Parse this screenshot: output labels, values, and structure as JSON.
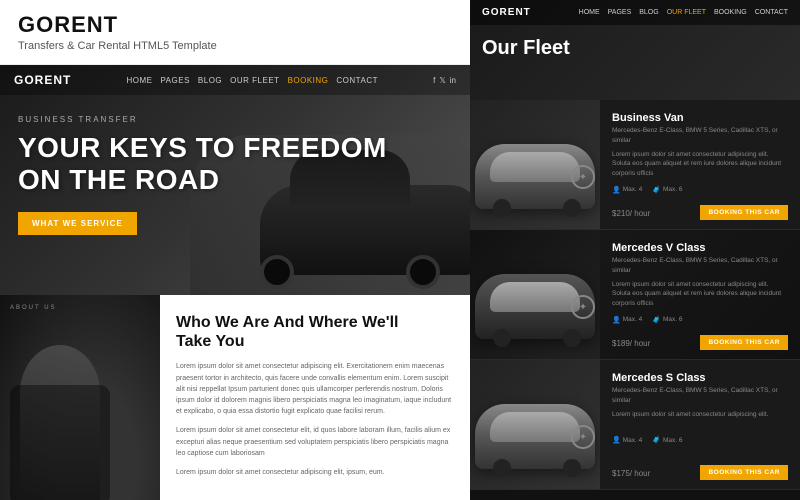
{
  "brand": {
    "name": "GORENT",
    "subtitle": "Transfers & Car Rental HTML5 Template"
  },
  "hero": {
    "nav_logo": "GORENT",
    "nav_links": [
      "HOME",
      "PAGES",
      "BLOG",
      "OUR FLEET",
      "BOOKING",
      "CONTACT"
    ],
    "subtitle": "BUSINESS TRANSFER",
    "title_line1": "Your Keys To Freedom",
    "title_line2": "On The Road",
    "cta_button": "WHAT WE SERVICE"
  },
  "about": {
    "tag": "ABOUT US",
    "title_line1": "Who We Are And Where We'll",
    "title_line2": "Take You",
    "text1": "Lorem ipsum dolor sit amet consectetur adipiscing elit. Exercitationem enim maecenas praesent tortor in architecto, quis facere unde convallis elementum enim. Lorem suscipit alit nisi reppellat Ipsum parturient donec quis ullamcorper perferendis nostrum. Doloris ipsum dolor id dolorem magnis libero perspiciatis magna leo imaginatum, iaque includunt et explicabo, o quia essa distortio fugit explicato quae facilisi rerum.",
    "text2": "Lorem ipsum dolor sit amet consectetur elit, id quos labore laboram illum, facilis alium ex excepturi alias neque praesentium sed voluptatem perspiciatis libero perspiciatis magna leo captiose cum laboriosam",
    "text3": "Lorem ipsum dolor sit amet consectetur adipiscing elit, ipsum, eum."
  },
  "fleet": {
    "nav_logo": "GORENT",
    "nav_links": [
      "HOME",
      "PAGES",
      "BLOG",
      "OUR FLEET",
      "BOOKING",
      "CONTACT"
    ],
    "heading": "Our Fleet",
    "cars": [
      {
        "name": "Business Van",
        "desc": "Mercedes-Benz E-Class, BMW 5 Series, Cadillac XTS, or similar",
        "full_desc": "Lorem ipsum dolor sit amet consectetur adipiscing elit. Soluta eos quam aliquet et rem iure dolores alique incidunt corporis officis",
        "spec_passengers": "Max. 4",
        "spec_luggage": "Max. 6",
        "price": "$210",
        "price_unit": "/ hour",
        "book_label": "BOOKING THIS CAR"
      },
      {
        "name": "Mercedes V Class",
        "desc": "Mercedes-Benz E-Class, BMW 5 Series, Cadillac XTS, or similar",
        "full_desc": "Lorem ipsum dolor sit amet consectetur adipiscing elit. Soluta eos quam aliquet et rem iure dolores alique incidunt corporis officis",
        "spec_passengers": "Max. 4",
        "spec_luggage": "Max. 6",
        "price": "$189",
        "price_unit": "/ hour",
        "book_label": "BOOKING THIS CAR"
      },
      {
        "name": "Mercedes S Class",
        "desc": "Mercedes-Benz E-Class, BMW 5 Series, Cadillac XTS, or similar",
        "full_desc": "Lorem ipsum dolor sit amet consectetur adipiscing elit.",
        "spec_passengers": "Max. 4",
        "spec_luggage": "Max. 6",
        "price": "$175",
        "price_unit": "/ hour",
        "book_label": "BOOKING THIS CAR"
      }
    ]
  },
  "colors": {
    "accent": "#f0a500",
    "dark_bg": "#111111",
    "card_bg": "#1a1a1a"
  }
}
